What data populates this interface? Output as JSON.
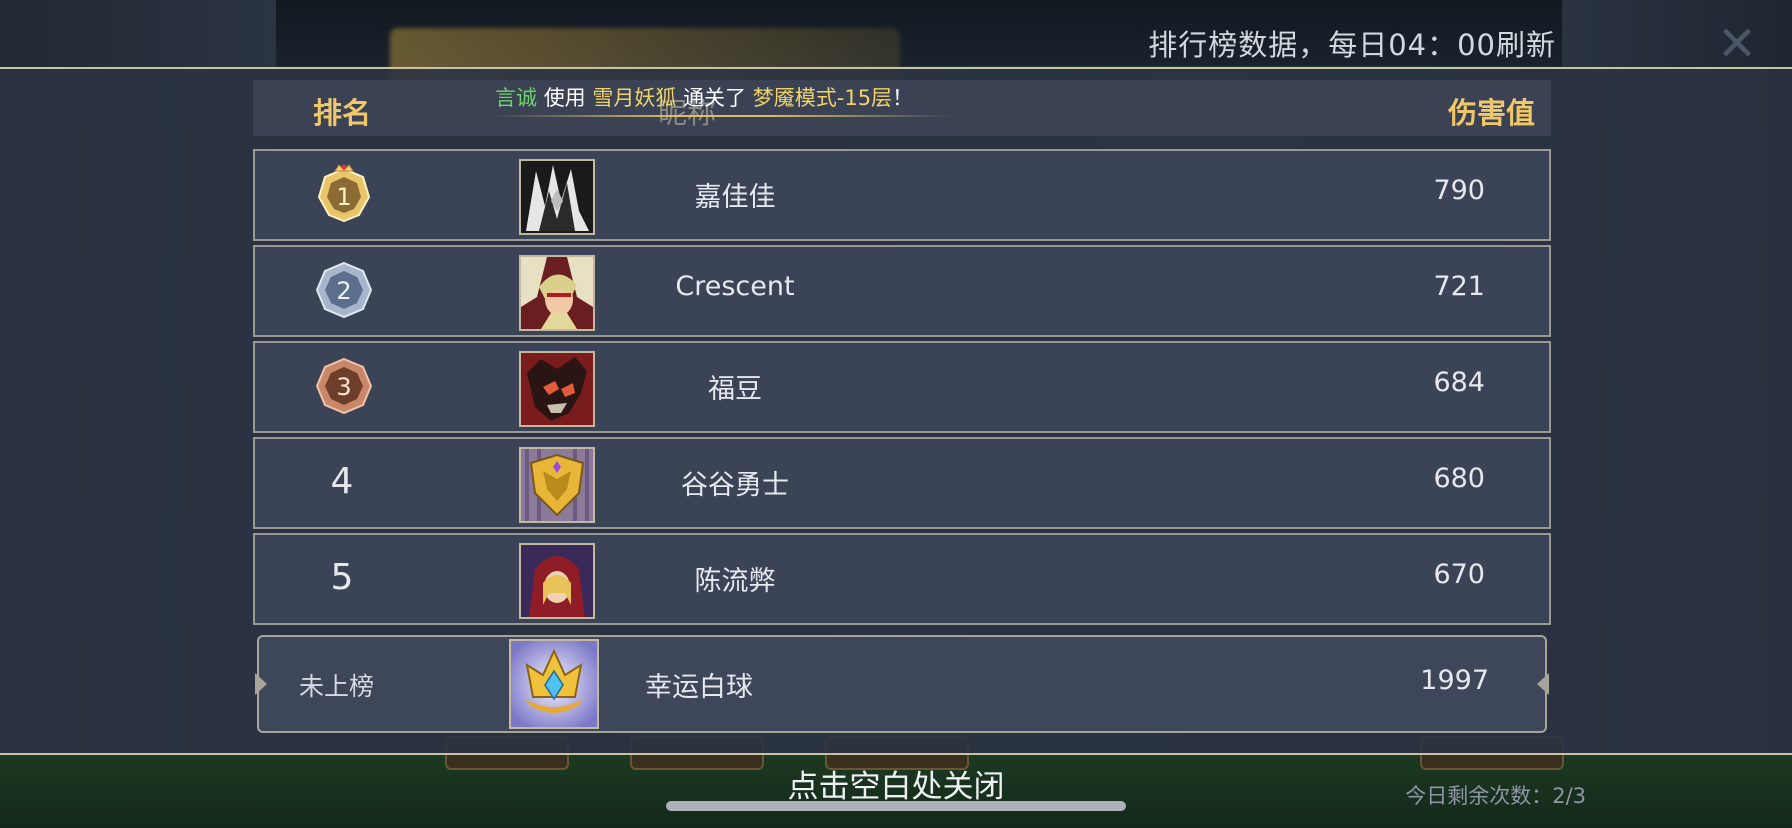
{
  "header": {
    "refresh_note": "排行榜数据，每日04：00刷新",
    "close_icon": "close-x-icon"
  },
  "table": {
    "col_rank": "排名",
    "col_nickname": "昵称",
    "col_damage": "伤害值"
  },
  "announcement": {
    "player": "言诚",
    "verb_use": "使用",
    "hero": "雪月妖狐",
    "verb_clear": "通关了",
    "stage": "梦魇模式-15层",
    "end": "！"
  },
  "rows": [
    {
      "rank": "1",
      "name": "嘉佳佳",
      "damage": "790",
      "medal": "gold-crown-medal"
    },
    {
      "rank": "2",
      "name": "Crescent",
      "damage": "721",
      "medal": "silver-medal"
    },
    {
      "rank": "3",
      "name": "福豆",
      "damage": "684",
      "medal": "bronze-medal"
    },
    {
      "rank": "4",
      "name": "谷谷勇士",
      "damage": "680"
    },
    {
      "rank": "5",
      "name": "陈流弊",
      "damage": "670"
    }
  ],
  "own": {
    "rank_text": "未上榜",
    "name": "幸运白球",
    "damage": "1997"
  },
  "footer": {
    "close_hint": "点击空白处关闭",
    "attempts": "今日剩余次数：2/3"
  },
  "colors": {
    "gold": "#f0c86a",
    "panel": "#2b3342",
    "row": "#3b4356",
    "highlight_green": "#6dd36a",
    "highlight_yellow": "#f1d36b"
  }
}
